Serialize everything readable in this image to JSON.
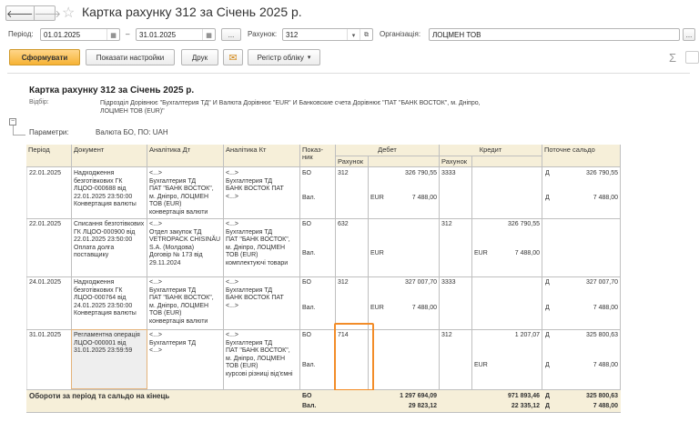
{
  "window": {
    "title": "Картка рахунку 312 за Січень 2025 р."
  },
  "nav": {
    "back": "🡐",
    "forward": "🡒",
    "favorite": "☆"
  },
  "filters": {
    "period_label": "Період:",
    "date_from": "01.01.2025",
    "dash": "–",
    "date_to": "31.01.2025",
    "ellipsis": "...",
    "account_label": "Рахунок:",
    "account": "312",
    "org_label": "Організація:",
    "org": "ЛОЦМЕН ТОВ"
  },
  "toolbar": {
    "generate": "Сформувати",
    "settings": "Показати настройки",
    "print": "Друк",
    "register": "Регістр обліку",
    "sigma": "Σ"
  },
  "report": {
    "title": "Картка рахунку 312 за Січень 2025 р.",
    "selection_label": "Відбір:",
    "selection_value": "Підрозділ Дорівнює \"Бухгалтерия ТД\" И Валюта Дорівнює \"EUR\" И Банковские счета Дорівнює \"ПАТ \"БАНК ВОСТОК\", м. Дніпро, ЛОЦМЕН ТОВ (EUR)\"",
    "collapse": "−",
    "params_label": "Параметри:",
    "params_value": "Валюта БО, ПО: UAH"
  },
  "columns": {
    "period": "Період",
    "document": "Документ",
    "analytics_dt": "Аналітика Дт",
    "analytics_kt": "Аналітика Кт",
    "indicator": "Показ-ник",
    "debit": "Дебет",
    "credit": "Кредит",
    "account": "Рахунок",
    "balance": "Поточне сальдо"
  },
  "rows": [
    {
      "date": "22.01.2025",
      "doc": "Надходження безготівкових ГК ЛЦОО-000688 від 22.01.2025 23:50:00 Конвертация валюты",
      "dt": "<...>\nБухгалтерия ТД\nПАТ \"БАНК ВОСТОК\", м. Дніпро, ЛОЦМЕН ТОВ (EUR)\nконвертація валюти",
      "kt": "<...>\nБухгалтерия ТД\nБАНК ВОСТОК ПАТ\n<...>",
      "ind1": "БО",
      "ind2": "Вал.",
      "dacc": "312",
      "dsum": "326 790,55",
      "dcur": "EUR",
      "dval": "7 488,00",
      "kacc": "3333",
      "ksum": "",
      "kcur": "",
      "kval": "",
      "bal_side1": "Д",
      "bal1": "326 790,55",
      "bal_side2": "Д",
      "bal2": "7 488,00"
    },
    {
      "date": "22.01.2025",
      "doc": "Списання безготівкових ГК ЛЦОО-000900 від 22.01.2025 23:50:00 Оплата долга поставщику",
      "dt": "<...>\nОтдел закупок ТД\nVETROPACK CHISINĂU S.A. (Молдова)\nДоговір № 173 від 29.11.2024",
      "kt": "<...>\nБухгалтерия ТД\nПАТ \"БАНК ВОСТОК\", м. Дніпро, ЛОЦМЕН ТОВ (EUR)\nкомплектуючі товари",
      "ind1": "БО",
      "ind2": "Вал.",
      "dacc": "632",
      "dsum": "",
      "dcur": "EUR",
      "dval": "",
      "kacc": "312",
      "ksum": "326 790,55",
      "kcur": "EUR",
      "kval": "7 488,00",
      "bal_side1": "",
      "bal1": "",
      "bal_side2": "",
      "bal2": ""
    },
    {
      "date": "24.01.2025",
      "doc": "Надходження безготівкових ГК ЛЦОО-000764 від 24.01.2025 23:50:00 Конвертация валюты",
      "dt": "<...>\nБухгалтерия ТД\nПАТ \"БАНК ВОСТОК\", м. Дніпро, ЛОЦМЕН ТОВ (EUR)\nконвертація валюти",
      "kt": "<...>\nБухгалтерия ТД\nБАНК ВОСТОК ПАТ\n<...>",
      "ind1": "БО",
      "ind2": "Вал.",
      "dacc": "312",
      "dsum": "327 007,70",
      "dcur": "EUR",
      "dval": "7 488,00",
      "kacc": "3333",
      "ksum": "",
      "kcur": "",
      "kval": "",
      "bal_side1": "Д",
      "bal1": "327 007,70",
      "bal_side2": "Д",
      "bal2": "7 488,00"
    },
    {
      "date": "31.01.2025",
      "doc": "Регламентна операція ЛЦОО-000001 від 31.01.2025 23:59:59",
      "dt": "<...>\nБухгалтерия ТД\n<...>",
      "kt": "<...>\nБухгалтерия ТД\nПАТ \"БАНК ВОСТОК\", м. Дніпро, ЛОЦМЕН ТОВ (EUR)\nкурсові різниці від'ємні",
      "ind1": "БО",
      "ind2": "Вал.",
      "dacc": "714",
      "dsum": "",
      "dcur": "",
      "dval": "",
      "kacc": "312",
      "ksum": "1 207,07",
      "kcur": "EUR",
      "kval": "",
      "bal_side1": "Д",
      "bal1": "325 800,63",
      "bal_side2": "Д",
      "bal2": "7 488,00"
    }
  ],
  "totals": {
    "label": "Обороти за період та сальдо на кінець",
    "ind1": "БО",
    "ind2": "Вал.",
    "dsum": "1 297 694,09",
    "dval": "29 823,12",
    "ksum": "971 893,46",
    "kval": "22 335,12",
    "side1": "Д",
    "bal1": "325 800,63",
    "side2": "Д",
    "bal2": "7 488,00"
  }
}
